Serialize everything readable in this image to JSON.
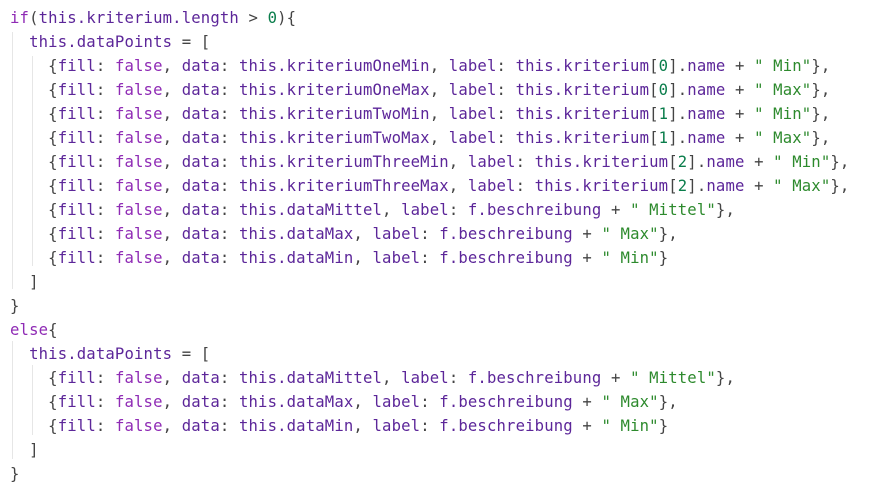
{
  "editor": {
    "colors": {
      "keyword": "#8f2bb5",
      "identifier": "#5c2699",
      "number": "#0a7d4b",
      "string": "#2d8a2d",
      "punctuation": "#444444",
      "background": "#ffffff"
    },
    "lines": [
      [
        [
          "kw",
          "if"
        ],
        [
          "pun",
          "("
        ],
        [
          "id",
          "this.kriterium.length"
        ],
        [
          "pun",
          " > "
        ],
        [
          "num",
          "0"
        ],
        [
          "pun",
          "){"
        ]
      ],
      [
        [
          "pun",
          "  "
        ],
        [
          "id",
          "this.dataPoints"
        ],
        [
          "pun",
          " = ["
        ]
      ],
      [
        [
          "pun",
          "    {"
        ],
        [
          "id",
          "fill"
        ],
        [
          "pun",
          ": "
        ],
        [
          "kw",
          "false"
        ],
        [
          "pun",
          ", "
        ],
        [
          "id",
          "data"
        ],
        [
          "pun",
          ": "
        ],
        [
          "id",
          "this.kriteriumOneMin"
        ],
        [
          "pun",
          ", "
        ],
        [
          "id",
          "label"
        ],
        [
          "pun",
          ": "
        ],
        [
          "id",
          "this.kriterium"
        ],
        [
          "pun",
          "["
        ],
        [
          "num",
          "0"
        ],
        [
          "pun",
          "]."
        ],
        [
          "id",
          "name"
        ],
        [
          "pun",
          " + "
        ],
        [
          "str",
          "\" Min\""
        ],
        [
          "pun",
          "},"
        ]
      ],
      [
        [
          "pun",
          "    {"
        ],
        [
          "id",
          "fill"
        ],
        [
          "pun",
          ": "
        ],
        [
          "kw",
          "false"
        ],
        [
          "pun",
          ", "
        ],
        [
          "id",
          "data"
        ],
        [
          "pun",
          ": "
        ],
        [
          "id",
          "this.kriteriumOneMax"
        ],
        [
          "pun",
          ", "
        ],
        [
          "id",
          "label"
        ],
        [
          "pun",
          ": "
        ],
        [
          "id",
          "this.kriterium"
        ],
        [
          "pun",
          "["
        ],
        [
          "num",
          "0"
        ],
        [
          "pun",
          "]."
        ],
        [
          "id",
          "name"
        ],
        [
          "pun",
          " + "
        ],
        [
          "str",
          "\" Max\""
        ],
        [
          "pun",
          "},"
        ]
      ],
      [
        [
          "pun",
          "    {"
        ],
        [
          "id",
          "fill"
        ],
        [
          "pun",
          ": "
        ],
        [
          "kw",
          "false"
        ],
        [
          "pun",
          ", "
        ],
        [
          "id",
          "data"
        ],
        [
          "pun",
          ": "
        ],
        [
          "id",
          "this.kriteriumTwoMin"
        ],
        [
          "pun",
          ", "
        ],
        [
          "id",
          "label"
        ],
        [
          "pun",
          ": "
        ],
        [
          "id",
          "this.kriterium"
        ],
        [
          "pun",
          "["
        ],
        [
          "num",
          "1"
        ],
        [
          "pun",
          "]."
        ],
        [
          "id",
          "name"
        ],
        [
          "pun",
          " + "
        ],
        [
          "str",
          "\" Min\""
        ],
        [
          "pun",
          "},"
        ]
      ],
      [
        [
          "pun",
          "    {"
        ],
        [
          "id",
          "fill"
        ],
        [
          "pun",
          ": "
        ],
        [
          "kw",
          "false"
        ],
        [
          "pun",
          ", "
        ],
        [
          "id",
          "data"
        ],
        [
          "pun",
          ": "
        ],
        [
          "id",
          "this.kriteriumTwoMax"
        ],
        [
          "pun",
          ", "
        ],
        [
          "id",
          "label"
        ],
        [
          "pun",
          ": "
        ],
        [
          "id",
          "this.kriterium"
        ],
        [
          "pun",
          "["
        ],
        [
          "num",
          "1"
        ],
        [
          "pun",
          "]."
        ],
        [
          "id",
          "name"
        ],
        [
          "pun",
          " + "
        ],
        [
          "str",
          "\" Max\""
        ],
        [
          "pun",
          "},"
        ]
      ],
      [
        [
          "pun",
          "    {"
        ],
        [
          "id",
          "fill"
        ],
        [
          "pun",
          ": "
        ],
        [
          "kw",
          "false"
        ],
        [
          "pun",
          ", "
        ],
        [
          "id",
          "data"
        ],
        [
          "pun",
          ": "
        ],
        [
          "id",
          "this.kriteriumThreeMin"
        ],
        [
          "pun",
          ", "
        ],
        [
          "id",
          "label"
        ],
        [
          "pun",
          ": "
        ],
        [
          "id",
          "this.kriterium"
        ],
        [
          "pun",
          "["
        ],
        [
          "num",
          "2"
        ],
        [
          "pun",
          "]."
        ],
        [
          "id",
          "name"
        ],
        [
          "pun",
          " + "
        ],
        [
          "str",
          "\" Min\""
        ],
        [
          "pun",
          "},"
        ]
      ],
      [
        [
          "pun",
          "    {"
        ],
        [
          "id",
          "fill"
        ],
        [
          "pun",
          ": "
        ],
        [
          "kw",
          "false"
        ],
        [
          "pun",
          ", "
        ],
        [
          "id",
          "data"
        ],
        [
          "pun",
          ": "
        ],
        [
          "id",
          "this.kriteriumThreeMax"
        ],
        [
          "pun",
          ", "
        ],
        [
          "id",
          "label"
        ],
        [
          "pun",
          ": "
        ],
        [
          "id",
          "this.kriterium"
        ],
        [
          "pun",
          "["
        ],
        [
          "num",
          "2"
        ],
        [
          "pun",
          "]."
        ],
        [
          "id",
          "name"
        ],
        [
          "pun",
          " + "
        ],
        [
          "str",
          "\" Max\""
        ],
        [
          "pun",
          "},"
        ]
      ],
      [
        [
          "pun",
          "    {"
        ],
        [
          "id",
          "fill"
        ],
        [
          "pun",
          ": "
        ],
        [
          "kw",
          "false"
        ],
        [
          "pun",
          ", "
        ],
        [
          "id",
          "data"
        ],
        [
          "pun",
          ": "
        ],
        [
          "id",
          "this.dataMittel"
        ],
        [
          "pun",
          ", "
        ],
        [
          "id",
          "label"
        ],
        [
          "pun",
          ": "
        ],
        [
          "id",
          "f.beschreibung"
        ],
        [
          "pun",
          " + "
        ],
        [
          "str",
          "\" Mittel\""
        ],
        [
          "pun",
          "},"
        ]
      ],
      [
        [
          "pun",
          "    {"
        ],
        [
          "id",
          "fill"
        ],
        [
          "pun",
          ": "
        ],
        [
          "kw",
          "false"
        ],
        [
          "pun",
          ", "
        ],
        [
          "id",
          "data"
        ],
        [
          "pun",
          ": "
        ],
        [
          "id",
          "this.dataMax"
        ],
        [
          "pun",
          ", "
        ],
        [
          "id",
          "label"
        ],
        [
          "pun",
          ": "
        ],
        [
          "id",
          "f.beschreibung"
        ],
        [
          "pun",
          " + "
        ],
        [
          "str",
          "\" Max\""
        ],
        [
          "pun",
          "},"
        ]
      ],
      [
        [
          "pun",
          "    {"
        ],
        [
          "id",
          "fill"
        ],
        [
          "pun",
          ": "
        ],
        [
          "kw",
          "false"
        ],
        [
          "pun",
          ", "
        ],
        [
          "id",
          "data"
        ],
        [
          "pun",
          ": "
        ],
        [
          "id",
          "this.dataMin"
        ],
        [
          "pun",
          ", "
        ],
        [
          "id",
          "label"
        ],
        [
          "pun",
          ": "
        ],
        [
          "id",
          "f.beschreibung"
        ],
        [
          "pun",
          " + "
        ],
        [
          "str",
          "\" Min\""
        ],
        [
          "pun",
          "}"
        ]
      ],
      [
        [
          "pun",
          "  ]"
        ]
      ],
      [
        [
          "pun",
          "}"
        ]
      ],
      [
        [
          "kw",
          "else"
        ],
        [
          "pun",
          "{"
        ]
      ],
      [
        [
          "pun",
          "  "
        ],
        [
          "id",
          "this.dataPoints"
        ],
        [
          "pun",
          " = ["
        ]
      ],
      [
        [
          "pun",
          "    {"
        ],
        [
          "id",
          "fill"
        ],
        [
          "pun",
          ": "
        ],
        [
          "kw",
          "false"
        ],
        [
          "pun",
          ", "
        ],
        [
          "id",
          "data"
        ],
        [
          "pun",
          ": "
        ],
        [
          "id",
          "this.dataMittel"
        ],
        [
          "pun",
          ", "
        ],
        [
          "id",
          "label"
        ],
        [
          "pun",
          ": "
        ],
        [
          "id",
          "f.beschreibung"
        ],
        [
          "pun",
          " + "
        ],
        [
          "str",
          "\" Mittel\""
        ],
        [
          "pun",
          "},"
        ]
      ],
      [
        [
          "pun",
          "    {"
        ],
        [
          "id",
          "fill"
        ],
        [
          "pun",
          ": "
        ],
        [
          "kw",
          "false"
        ],
        [
          "pun",
          ", "
        ],
        [
          "id",
          "data"
        ],
        [
          "pun",
          ": "
        ],
        [
          "id",
          "this.dataMax"
        ],
        [
          "pun",
          ", "
        ],
        [
          "id",
          "label"
        ],
        [
          "pun",
          ": "
        ],
        [
          "id",
          "f.beschreibung"
        ],
        [
          "pun",
          " + "
        ],
        [
          "str",
          "\" Max\""
        ],
        [
          "pun",
          "},"
        ]
      ],
      [
        [
          "pun",
          "    {"
        ],
        [
          "id",
          "fill"
        ],
        [
          "pun",
          ": "
        ],
        [
          "kw",
          "false"
        ],
        [
          "pun",
          ", "
        ],
        [
          "id",
          "data"
        ],
        [
          "pun",
          ": "
        ],
        [
          "id",
          "this.dataMin"
        ],
        [
          "pun",
          ", "
        ],
        [
          "id",
          "label"
        ],
        [
          "pun",
          ": "
        ],
        [
          "id",
          "f.beschreibung"
        ],
        [
          "pun",
          " + "
        ],
        [
          "str",
          "\" Min\""
        ],
        [
          "pun",
          "}"
        ]
      ],
      [
        [
          "pun",
          "  ]"
        ]
      ],
      [
        [
          "pun",
          "}"
        ]
      ]
    ]
  }
}
